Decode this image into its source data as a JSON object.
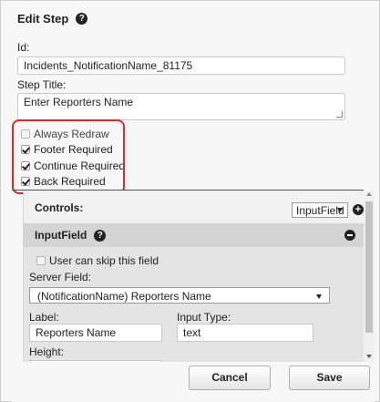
{
  "dialog": {
    "title": "Edit Step",
    "help_icon": "help-circle-icon"
  },
  "form": {
    "id_label": "Id:",
    "id_value": "Incidents_NotificationName_81175",
    "step_title_label": "Step Title:",
    "step_title_value": "Enter Reporters Name"
  },
  "options": [
    {
      "label": "Always Redraw",
      "checked": false
    },
    {
      "label": "Footer Required",
      "checked": true
    },
    {
      "label": "Continue Required",
      "checked": true
    },
    {
      "label": "Back Required",
      "checked": true
    }
  ],
  "controls": {
    "label": "Controls:",
    "type_select": "InputField",
    "add_icon": "plus-circle-icon"
  },
  "input_field": {
    "title": "InputField",
    "help_icon": "help-circle-icon",
    "collapse_icon": "minus-circle-icon",
    "skip_label": "User can skip this field",
    "skip_checked": false,
    "server_field_label": "Server Field:",
    "server_field_value": "(NotificationName) Reporters Name",
    "label_label": "Label:",
    "label_value": "Reporters Name",
    "input_type_label": "Input Type:",
    "input_type_value": "text",
    "height_label": "Height:"
  },
  "buttons": {
    "cancel": "Cancel",
    "save": "Save"
  },
  "colors": {
    "highlight": "#d42a2a",
    "panel": "#e4e4e4",
    "panel_header": "#d4d4d4"
  }
}
